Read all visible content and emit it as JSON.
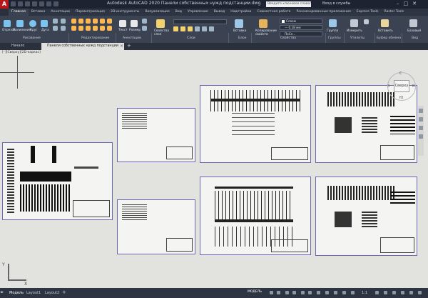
{
  "window": {
    "title": "Autodesk AutoCAD 2020   Панели собственных нужд подстанции.dwg",
    "search_placeholder": "Введите ключевое слово/фразу",
    "signin": "Вход в службы",
    "controls": [
      "–",
      "□",
      "✕"
    ],
    "logo": "A"
  },
  "ribbon_tabs": [
    "Главная",
    "Вставка",
    "Аннотации",
    "Параметризация",
    "3D-инструменты",
    "Визуализация",
    "Вид",
    "Управление",
    "Вывод",
    "Надстройки",
    "Совместная работа",
    "Рекомендованные приложения",
    "Express Tools",
    "Raster Tools"
  ],
  "ribbon": {
    "draw_buttons": [
      "Отрезок",
      "Полилиния",
      "Круг",
      "Дуга"
    ],
    "modify_panel": "Редактирование",
    "annotation_buttons": [
      "Текст",
      "Размер"
    ],
    "layer_props": "Свойства слоя",
    "insert": "Вставка",
    "match_props": "Копирование свойств",
    "color": "Слоем",
    "lineweight": "— 0.18 мм",
    "linetype": "ПоСл...",
    "group": "Группа",
    "measure": "Измерить",
    "paste": "Вставить",
    "base": "Базовый",
    "groups": [
      "Рисование",
      "Редактирование",
      "Аннотации",
      "Слои",
      "Блок",
      "Свойства",
      "Группы",
      "Утилиты",
      "Буфер обмена",
      "Вид"
    ]
  },
  "file_tabs": [
    "Начало",
    "Панели собственных нужд подстанции"
  ],
  "viewport_label": "[–][Сверху][2D-каркас]",
  "viewcube": {
    "face": "Сверху",
    "compass_n": "С",
    "compass_s": "Ю",
    "compass_w": "З",
    "compass_e": "В"
  },
  "ucs": {
    "x": "X",
    "y": "Y"
  },
  "layout_tabs": [
    "Модель",
    "Layout1",
    "Layout2"
  ],
  "status": {
    "model": "МОДЕЛЬ",
    "scale": "1:1"
  }
}
